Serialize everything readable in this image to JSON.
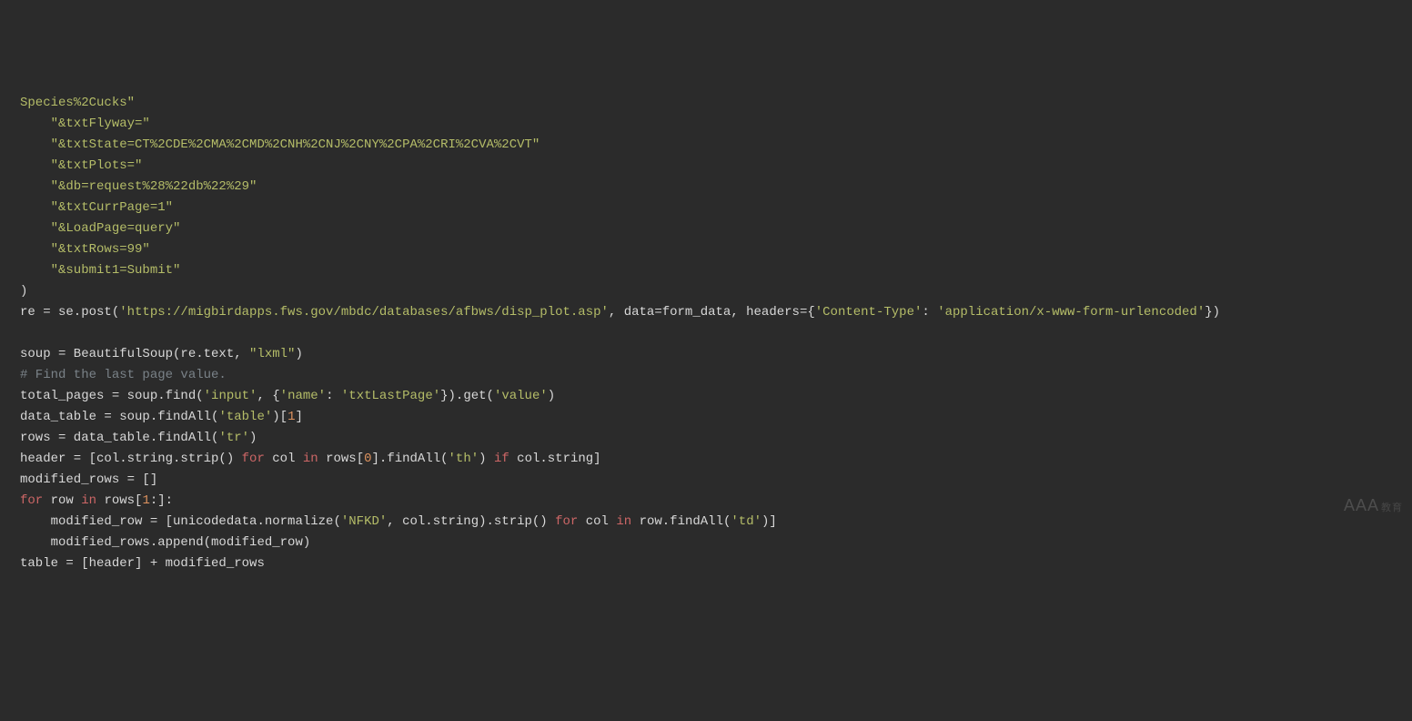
{
  "code": {
    "l01_a": "Species%2Cucks\"",
    "l02_a": "    \"&txtFlyway=\"",
    "l03_a": "    \"&txtState=CT%2CDE%2CMA%2CMD%2CNH%2CNJ%2CNY%2CPA%2CRI%2CVA%2CVT\"",
    "l04_a": "    \"&txtPlots=\"",
    "l05_a": "    \"&db=request%28%22db%22%29\"",
    "l06_a": "    \"&txtCurrPage=1\"",
    "l07_a": "    \"&LoadPage=query\"",
    "l08_a": "    \"&txtRows=99\"",
    "l09_a": "    \"&submit1=Submit\"",
    "l10_a": ")",
    "l11_a": "re = se.post(",
    "l11_b": "'https://migbirdapps.fws.gov/mbdc/databases/afbws/disp_plot.asp'",
    "l11_c": ", data=form_data, headers={",
    "l11_d": "'Content-Type'",
    "l11_e": ": ",
    "l11_f": "'application/x-www-form-urlencoded'",
    "l11_g": "})",
    "l13_a": "soup = BeautifulSoup(re.text, ",
    "l13_b": "\"lxml\"",
    "l13_c": ")",
    "l14_a": "# Find the last page value.",
    "l15_a": "total_pages = soup.find(",
    "l15_b": "'input'",
    "l15_c": ", {",
    "l15_d": "'name'",
    "l15_e": ": ",
    "l15_f": "'txtLastPage'",
    "l15_g": "}).get(",
    "l15_h": "'value'",
    "l15_i": ")",
    "l16_a": "data_table = soup.findAll(",
    "l16_b": "'table'",
    "l16_c": ")[",
    "l16_d": "1",
    "l16_e": "]",
    "l17_a": "rows = data_table.findAll(",
    "l17_b": "'tr'",
    "l17_c": ")",
    "l18_a": "header = [col.string.strip() ",
    "l18_b": "for",
    "l18_c": " col ",
    "l18_d": "in",
    "l18_e": " rows[",
    "l18_f": "0",
    "l18_g": "].findAll(",
    "l18_h": "'th'",
    "l18_i": ") ",
    "l18_j": "if",
    "l18_k": " col.string]",
    "l19_a": "modified_rows = []",
    "l20_a": "for",
    "l20_b": " row ",
    "l20_c": "in",
    "l20_d": " rows[",
    "l20_e": "1",
    "l20_f": ":]:",
    "l21_a": "    modified_row = [unicodedata.normalize(",
    "l21_b": "'NFKD'",
    "l21_c": ", col.string).strip() ",
    "l21_d": "for",
    "l21_e": " col ",
    "l21_f": "in",
    "l21_g": " row.findAll(",
    "l21_h": "'td'",
    "l21_i": ")]",
    "l22_a": "    modified_rows.append(modified_row)",
    "l23_a": "table = [header] + modified_rows"
  },
  "watermark": {
    "main": "AAA",
    "sub": "教育"
  }
}
